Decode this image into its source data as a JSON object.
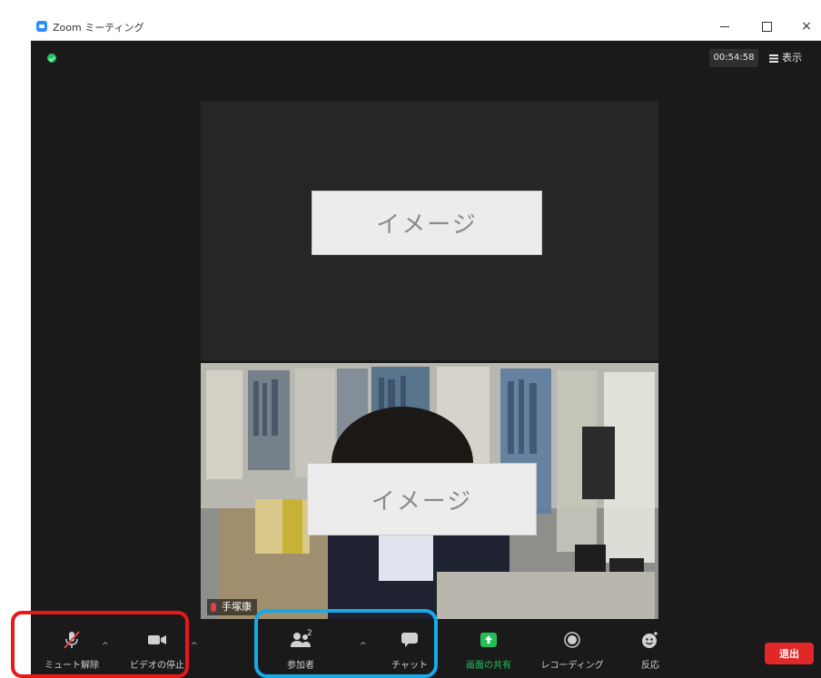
{
  "window": {
    "title": "Zoom ミーティング",
    "controls": {
      "minimize_icon": "minimize-icon",
      "maximize_icon": "maximize-icon",
      "close_label": "×"
    }
  },
  "header": {
    "timer": "00:54:58",
    "view_label": "表示",
    "encryption_icon": "shield-check-icon"
  },
  "video": {
    "tile1": {
      "placeholder": "イメージ"
    },
    "tile2": {
      "placeholder": "イメージ",
      "name_tag": "手塚康"
    }
  },
  "toolbar": {
    "unmute_label": "ミュート解除",
    "stop_video_label": "ビデオの停止",
    "participants_label": "参加者",
    "participants_count": "2",
    "chat_label": "チャット",
    "share_label": "画面の共有",
    "record_label": "レコーディング",
    "reactions_label": "反応",
    "leave_label": "退出",
    "caret": "^"
  },
  "colors": {
    "window_bg": "#1a1a1a",
    "tile_bg": "#262626",
    "share_green": "#23c05a",
    "leave_red": "#e02828",
    "highlight_red": "#e81818",
    "highlight_blue": "#18a9e8",
    "muted_red": "#e04545"
  }
}
